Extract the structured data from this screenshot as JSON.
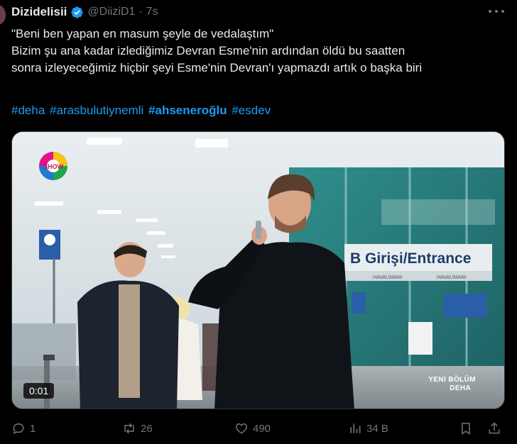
{
  "tweet": {
    "display_name": "Dizidelisii",
    "handle": "@DiiziD1",
    "separator": "·",
    "time": "7s",
    "lines": [
      "\"Beni ben yapan en masum şeyle de vedalaştım\"",
      "Bizim şu ana kadar izlediğimiz Devran Esme'nin ardından öldü bu saatten",
      "sonra izleyeceğimiz hiçbir şeyi Esme'nin Devran'ı yapmazdı artık o başka biri"
    ],
    "hashtags": [
      "#deha",
      "#arasbulutiynemli",
      "#ahseneroğlu",
      "#esdev"
    ]
  },
  "media": {
    "timer": "0:01",
    "channel_logo": "SHOW",
    "sign_text": "B Girişi/Entrance",
    "sign_sub_left": "HAVALİMANI",
    "sign_sub_right": "HAVALİMANI",
    "watermark_line1": "YENİ BÖLÜM",
    "watermark_line2": "DEHA"
  },
  "actions": {
    "replies": "1",
    "reposts": "26",
    "likes": "490",
    "views": "34 B"
  },
  "colors": {
    "accent": "#1d9bf0",
    "muted": "#71767b",
    "text": "#e7e9ea",
    "background": "#000000"
  },
  "icons": [
    "verified-badge-icon",
    "more-icon",
    "reply-icon",
    "repost-icon",
    "like-icon",
    "views-icon",
    "bookmark-icon",
    "share-icon"
  ]
}
